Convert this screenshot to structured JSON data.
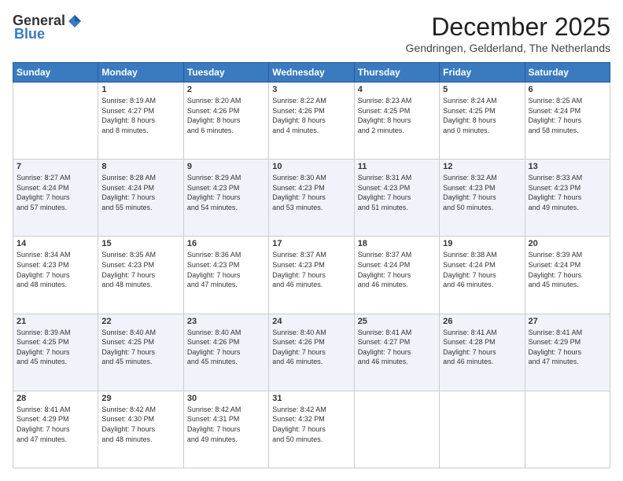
{
  "header": {
    "logo_general": "General",
    "logo_blue": "Blue",
    "month_title": "December 2025",
    "subtitle": "Gendringen, Gelderland, The Netherlands"
  },
  "days_of_week": [
    "Sunday",
    "Monday",
    "Tuesday",
    "Wednesday",
    "Thursday",
    "Friday",
    "Saturday"
  ],
  "weeks": [
    [
      {
        "day": "",
        "info": ""
      },
      {
        "day": "1",
        "info": "Sunrise: 8:19 AM\nSunset: 4:27 PM\nDaylight: 8 hours\nand 8 minutes."
      },
      {
        "day": "2",
        "info": "Sunrise: 8:20 AM\nSunset: 4:26 PM\nDaylight: 8 hours\nand 6 minutes."
      },
      {
        "day": "3",
        "info": "Sunrise: 8:22 AM\nSunset: 4:26 PM\nDaylight: 8 hours\nand 4 minutes."
      },
      {
        "day": "4",
        "info": "Sunrise: 8:23 AM\nSunset: 4:25 PM\nDaylight: 8 hours\nand 2 minutes."
      },
      {
        "day": "5",
        "info": "Sunrise: 8:24 AM\nSunset: 4:25 PM\nDaylight: 8 hours\nand 0 minutes."
      },
      {
        "day": "6",
        "info": "Sunrise: 8:25 AM\nSunset: 4:24 PM\nDaylight: 7 hours\nand 58 minutes."
      }
    ],
    [
      {
        "day": "7",
        "info": "Sunrise: 8:27 AM\nSunset: 4:24 PM\nDaylight: 7 hours\nand 57 minutes."
      },
      {
        "day": "8",
        "info": "Sunrise: 8:28 AM\nSunset: 4:24 PM\nDaylight: 7 hours\nand 55 minutes."
      },
      {
        "day": "9",
        "info": "Sunrise: 8:29 AM\nSunset: 4:23 PM\nDaylight: 7 hours\nand 54 minutes."
      },
      {
        "day": "10",
        "info": "Sunrise: 8:30 AM\nSunset: 4:23 PM\nDaylight: 7 hours\nand 53 minutes."
      },
      {
        "day": "11",
        "info": "Sunrise: 8:31 AM\nSunset: 4:23 PM\nDaylight: 7 hours\nand 51 minutes."
      },
      {
        "day": "12",
        "info": "Sunrise: 8:32 AM\nSunset: 4:23 PM\nDaylight: 7 hours\nand 50 minutes."
      },
      {
        "day": "13",
        "info": "Sunrise: 8:33 AM\nSunset: 4:23 PM\nDaylight: 7 hours\nand 49 minutes."
      }
    ],
    [
      {
        "day": "14",
        "info": "Sunrise: 8:34 AM\nSunset: 4:23 PM\nDaylight: 7 hours\nand 48 minutes."
      },
      {
        "day": "15",
        "info": "Sunrise: 8:35 AM\nSunset: 4:23 PM\nDaylight: 7 hours\nand 48 minutes."
      },
      {
        "day": "16",
        "info": "Sunrise: 8:36 AM\nSunset: 4:23 PM\nDaylight: 7 hours\nand 47 minutes."
      },
      {
        "day": "17",
        "info": "Sunrise: 8:37 AM\nSunset: 4:23 PM\nDaylight: 7 hours\nand 46 minutes."
      },
      {
        "day": "18",
        "info": "Sunrise: 8:37 AM\nSunset: 4:24 PM\nDaylight: 7 hours\nand 46 minutes."
      },
      {
        "day": "19",
        "info": "Sunrise: 8:38 AM\nSunset: 4:24 PM\nDaylight: 7 hours\nand 46 minutes."
      },
      {
        "day": "20",
        "info": "Sunrise: 8:39 AM\nSunset: 4:24 PM\nDaylight: 7 hours\nand 45 minutes."
      }
    ],
    [
      {
        "day": "21",
        "info": "Sunrise: 8:39 AM\nSunset: 4:25 PM\nDaylight: 7 hours\nand 45 minutes."
      },
      {
        "day": "22",
        "info": "Sunrise: 8:40 AM\nSunset: 4:25 PM\nDaylight: 7 hours\nand 45 minutes."
      },
      {
        "day": "23",
        "info": "Sunrise: 8:40 AM\nSunset: 4:26 PM\nDaylight: 7 hours\nand 45 minutes."
      },
      {
        "day": "24",
        "info": "Sunrise: 8:40 AM\nSunset: 4:26 PM\nDaylight: 7 hours\nand 46 minutes."
      },
      {
        "day": "25",
        "info": "Sunrise: 8:41 AM\nSunset: 4:27 PM\nDaylight: 7 hours\nand 46 minutes."
      },
      {
        "day": "26",
        "info": "Sunrise: 8:41 AM\nSunset: 4:28 PM\nDaylight: 7 hours\nand 46 minutes."
      },
      {
        "day": "27",
        "info": "Sunrise: 8:41 AM\nSunset: 4:29 PM\nDaylight: 7 hours\nand 47 minutes."
      }
    ],
    [
      {
        "day": "28",
        "info": "Sunrise: 8:41 AM\nSunset: 4:29 PM\nDaylight: 7 hours\nand 47 minutes."
      },
      {
        "day": "29",
        "info": "Sunrise: 8:42 AM\nSunset: 4:30 PM\nDaylight: 7 hours\nand 48 minutes."
      },
      {
        "day": "30",
        "info": "Sunrise: 8:42 AM\nSunset: 4:31 PM\nDaylight: 7 hours\nand 49 minutes."
      },
      {
        "day": "31",
        "info": "Sunrise: 8:42 AM\nSunset: 4:32 PM\nDaylight: 7 hours\nand 50 minutes."
      },
      {
        "day": "",
        "info": ""
      },
      {
        "day": "",
        "info": ""
      },
      {
        "day": "",
        "info": ""
      }
    ]
  ]
}
